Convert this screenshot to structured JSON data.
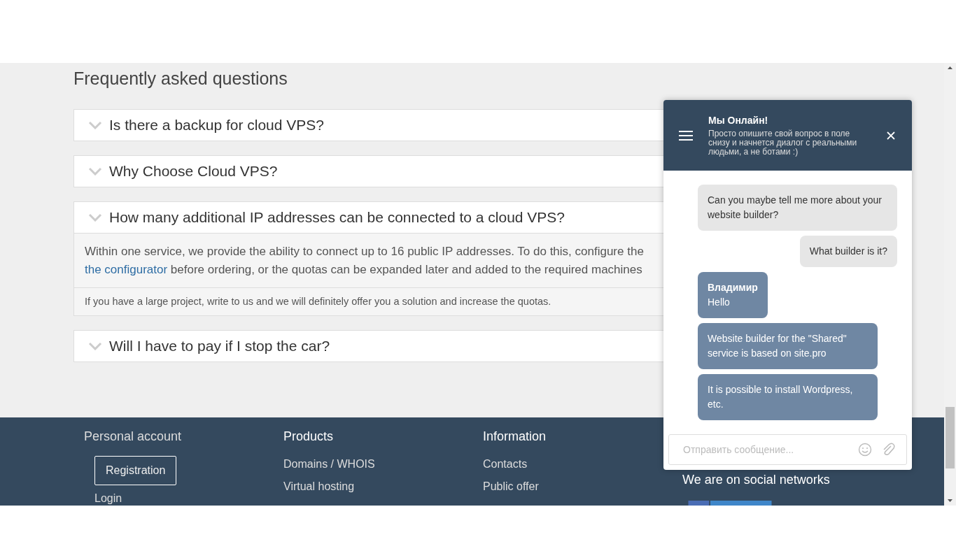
{
  "faq": {
    "title": "Frequently asked questions",
    "items": [
      {
        "question": "Is there a backup for cloud VPS?",
        "expanded": false
      },
      {
        "question": "Why Choose Cloud VPS?",
        "expanded": false
      },
      {
        "question": "How many additional IP addresses can be connected to a cloud VPS?",
        "expanded": true,
        "answer_line_1": "Within one service, we provide the ability to connect up to 16 public IP addresses. To do this, configure the",
        "answer_link": "the configurator",
        "answer_line_2_rest": " before ordering, or the quotas can be expanded later and added to the required machines",
        "note": "If you have a large project, write to us and we will definitely offer you a solution and increase the quotas."
      },
      {
        "question": "Will I have to pay if I stop the car?",
        "expanded": false
      }
    ]
  },
  "footer": {
    "personal_account": {
      "title": "Personal account",
      "button": "Registration",
      "login": "Login"
    },
    "columns": [
      {
        "title": "Products",
        "links": [
          "Domains / WHOIS",
          "Virtual hosting"
        ]
      },
      {
        "title": "Information",
        "links": [
          "Contacts",
          "Public offer"
        ]
      }
    ],
    "social_title": "We are on social networks"
  },
  "chat": {
    "title": "Мы Онлайн!",
    "subtitle": "Просто опишите свой вопрос в поле снизу и начнется диалог с реальными людьми, а не ботами :)",
    "messages": [
      {
        "kind": "user",
        "text": "Can you maybe tell me more about your website builder?"
      },
      {
        "kind": "user",
        "text": "What builder is it?"
      },
      {
        "kind": "agent",
        "author": "Владимир",
        "text": "Hello"
      },
      {
        "kind": "agent",
        "text": "Website builder for the \"Shared\" service is based on site.pro"
      },
      {
        "kind": "agent",
        "text": "It is possible to install Wordpress, etc."
      }
    ],
    "input": {
      "placeholder": "Отправить сообщение..."
    }
  }
}
